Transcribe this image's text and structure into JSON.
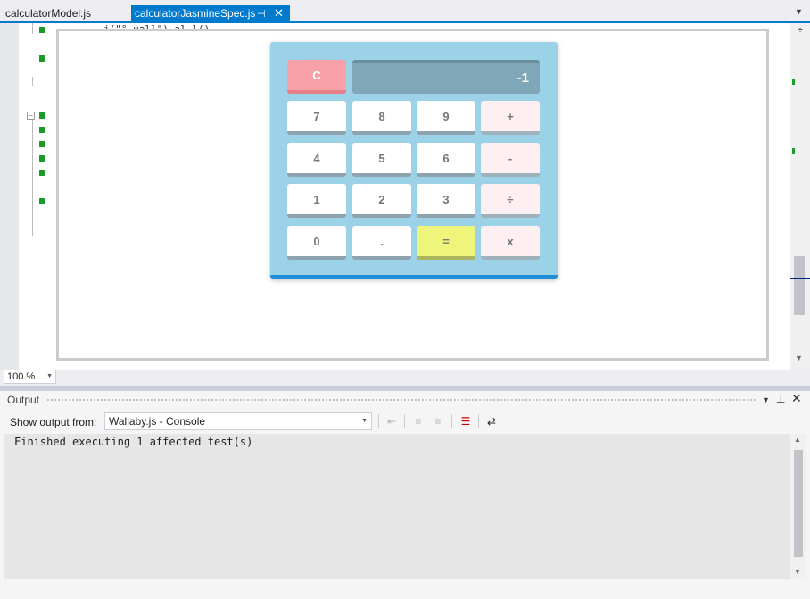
{
  "tabs": [
    {
      "label": "calculatorModel.js",
      "active": false
    },
    {
      "label": "calculatorJasmineSpec.js",
      "active": true
    }
  ],
  "tab_icons": {
    "pin": "pin-icon",
    "close": "close-icon",
    "overflow": "chevron-down-icon"
  },
  "editor": {
    "code_fragment": "j(\"°.uall\").al.l()"
  },
  "calculator": {
    "display_value": "-1",
    "keys": [
      {
        "label": "C",
        "kind": "clear"
      },
      {
        "label": "7",
        "kind": "digit"
      },
      {
        "label": "8",
        "kind": "digit"
      },
      {
        "label": "9",
        "kind": "digit"
      },
      {
        "label": "+",
        "kind": "op"
      },
      {
        "label": "4",
        "kind": "digit"
      },
      {
        "label": "5",
        "kind": "digit"
      },
      {
        "label": "6",
        "kind": "digit"
      },
      {
        "label": "-",
        "kind": "op"
      },
      {
        "label": "1",
        "kind": "digit"
      },
      {
        "label": "2",
        "kind": "digit"
      },
      {
        "label": "3",
        "kind": "digit"
      },
      {
        "label": "÷",
        "kind": "op"
      },
      {
        "label": "0",
        "kind": "digit"
      },
      {
        "label": ".",
        "kind": "digit"
      },
      {
        "label": "=",
        "kind": "equals"
      },
      {
        "label": "x",
        "kind": "op"
      }
    ],
    "colors": {
      "body": "#9cd2e8",
      "clear": "#f8a0a7",
      "equals": "#eef57a",
      "display": "#7fa7b8",
      "accent": "#1e8fd6"
    }
  },
  "zoom": {
    "value": "100 %"
  },
  "output": {
    "title": "Output",
    "show_from_label": "Show output from:",
    "source": "Wallaby.js - Console",
    "text": "Finished executing 1 affected test(s)"
  },
  "accent_color": "#007acc"
}
